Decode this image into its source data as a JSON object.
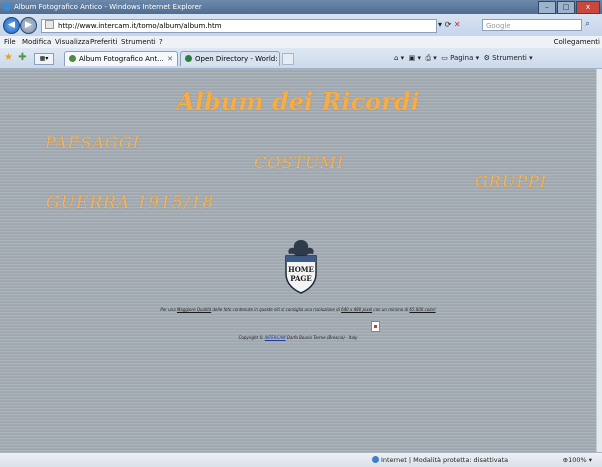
{
  "window": {
    "title": "Album Fotografico Antico - Windows Internet Explorer",
    "buttons": [
      "–",
      "□",
      "x"
    ]
  },
  "address_bar": {
    "url": "http://www.intercam.it/tomo/album/album.htm",
    "search_placeholder": "Google"
  },
  "menu": {
    "items": [
      "File",
      "Modifica",
      "Visualizza",
      "Preferiti",
      "Strumenti",
      "?"
    ],
    "links_label": "Collegamenti"
  },
  "tabs": [
    {
      "label": "Album Fotografico Ant..."
    },
    {
      "label": "Open Directory - World: It..."
    }
  ],
  "command_bar": {
    "pagina": "Pagina",
    "strumenti": "Strumenti"
  },
  "page": {
    "title": "Album dei Ricordi",
    "links": {
      "paesaggi": "PAESAGGI",
      "costumi": "COSTUMI",
      "gruppi": "GRUPPI",
      "guerra": "GUERRA 1915/18"
    },
    "home_label_1": "HOME",
    "home_label_2": "PAGE",
    "note_parts": {
      "before": "Per una ",
      "link": "Maggiore Qualità",
      "middle": " delle foto contenute in queste siti si consiglia una risoluzione di ",
      "res": "640 x 480 pixel",
      "after": " con un minimo di ",
      "colors": "65.000 colori"
    },
    "copyright_parts": {
      "before": "Copyright © ",
      "link": "INTERCAM",
      "after": " Darfo Boario Terme (Brescia) - Italy"
    }
  },
  "status": {
    "zone": "Internet | Modalità protetta: disattivata",
    "zoom": "100%"
  }
}
